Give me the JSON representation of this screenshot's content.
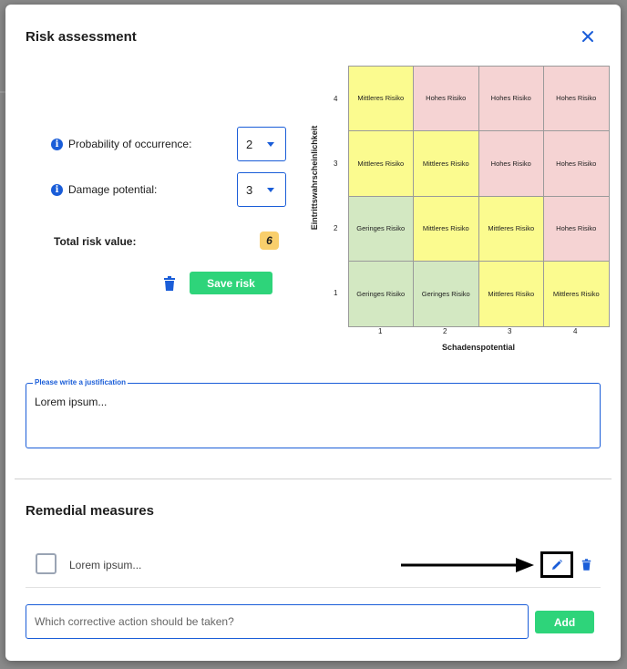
{
  "modal": {
    "title": "Risk assessment"
  },
  "fields": {
    "probability": {
      "label": "Probability of occurrence:",
      "value": "2"
    },
    "damage": {
      "label": "Damage potential:",
      "value": "3"
    }
  },
  "total": {
    "label": "Total risk value:",
    "value": "6"
  },
  "actions": {
    "save_label": "Save risk"
  },
  "matrix": {
    "ylabel": "Eintrittswahrscheinlichkeit",
    "xlabel": "Schadenspotential",
    "yticks": [
      "4",
      "3",
      "2",
      "1"
    ],
    "xticks": [
      "1",
      "2",
      "3",
      "4"
    ],
    "rows": [
      [
        {
          "text": "Mittleres Risiko",
          "level": "mid"
        },
        {
          "text": "Hohes Risiko",
          "level": "high"
        },
        {
          "text": "Hohes Risiko",
          "level": "high"
        },
        {
          "text": "Hohes Risiko",
          "level": "high"
        }
      ],
      [
        {
          "text": "Mittleres Risiko",
          "level": "mid"
        },
        {
          "text": "Mittleres Risiko",
          "level": "mid"
        },
        {
          "text": "Hohes Risiko",
          "level": "high"
        },
        {
          "text": "Hohes Risiko",
          "level": "high"
        }
      ],
      [
        {
          "text": "Geringes Risiko",
          "level": "low"
        },
        {
          "text": "Mittleres Risiko",
          "level": "mid"
        },
        {
          "text": "Mittleres Risiko",
          "level": "mid"
        },
        {
          "text": "Hohes Risiko",
          "level": "high"
        }
      ],
      [
        {
          "text": "Geringes Risiko",
          "level": "low"
        },
        {
          "text": "Geringes Risiko",
          "level": "low"
        },
        {
          "text": "Mittleres Risiko",
          "level": "mid"
        },
        {
          "text": "Mittleres Risiko",
          "level": "mid"
        }
      ]
    ],
    "colors": {
      "high": "#f5d3d3",
      "mid": "#fbfb8f",
      "low": "#d3e8c2"
    }
  },
  "justification": {
    "label": "Please write a justification",
    "text": "Lorem ipsum..."
  },
  "remedial": {
    "title": "Remedial measures",
    "items": [
      {
        "text": "Lorem ipsum..."
      }
    ],
    "placeholder": "Which corrective action should be taken?",
    "add_label": "Add"
  },
  "icons": [
    "close-icon",
    "info-icon",
    "chevron-down-icon",
    "trash-icon",
    "edit-icon",
    "arrow-right-icon"
  ],
  "colors": {
    "accent": "#1a5dd8",
    "success": "#2ed47a",
    "badge": "#f9cf6c"
  }
}
